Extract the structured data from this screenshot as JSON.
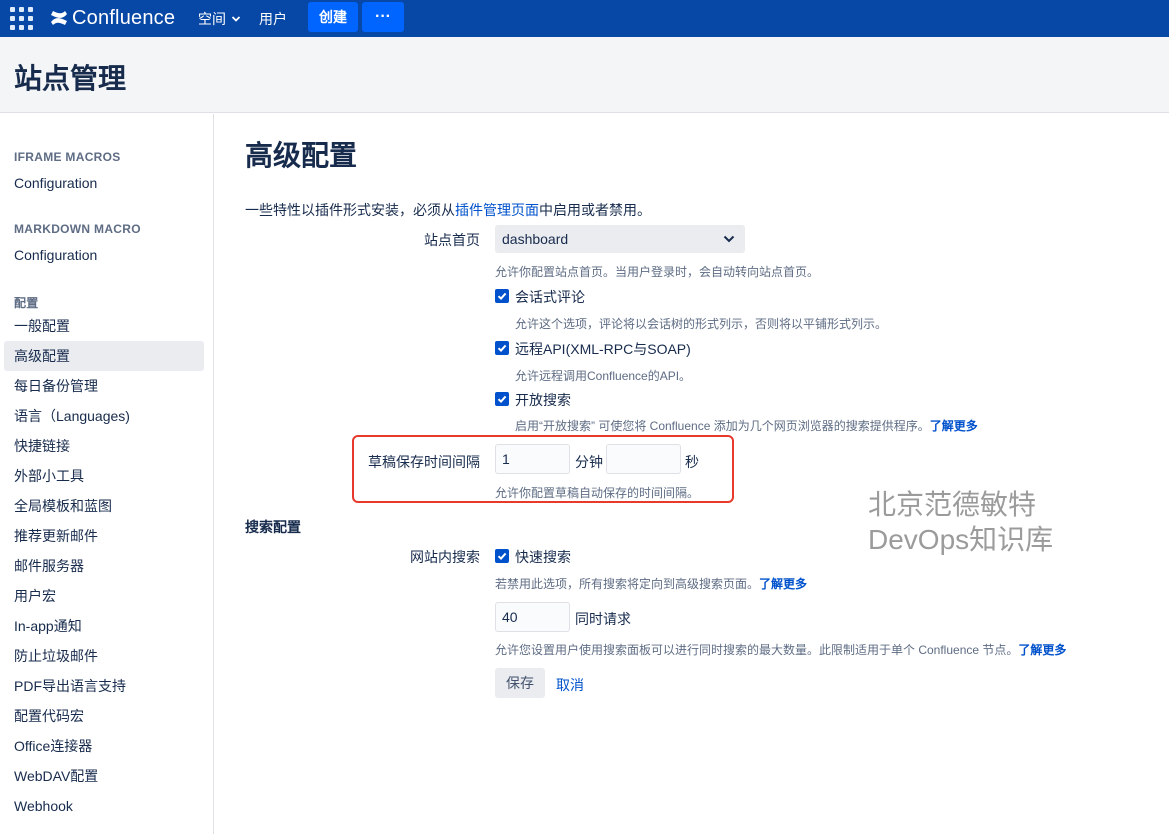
{
  "topbar": {
    "app_name": "Confluence",
    "nav_spaces": "空间",
    "nav_people": "用户",
    "create_label": "创建",
    "more_label": "···"
  },
  "page_header": {
    "title": "站点管理"
  },
  "sidebar": {
    "sections": [
      {
        "heading": "IFRAME MACROS",
        "items": [
          "Configuration"
        ]
      },
      {
        "heading": "MARKDOWN MACRO",
        "items": [
          "Configuration"
        ]
      },
      {
        "heading": "配置",
        "items": [
          "一般配置",
          "高级配置",
          "每日备份管理",
          "语言（Languages)",
          "快捷链接",
          "外部小工具",
          "全局模板和蓝图",
          "推荐更新邮件",
          "邮件服务器",
          "用户宏",
          "In-app通知",
          "防止垃圾邮件",
          "PDF导出语言支持",
          "配置代码宏",
          "Office连接器",
          "WebDAV配置",
          "Webhook"
        ]
      }
    ],
    "active_item": "高级配置"
  },
  "main": {
    "title": "高级配置",
    "intro_prefix": "一些特性以插件形式安装，必须从",
    "intro_link": "插件管理页面",
    "intro_suffix": "中启用或者禁用。",
    "site_home": {
      "label": "站点首页",
      "value": "dashboard",
      "desc": "允许你配置站点首页。当用户登录时，会自动转向站点首页。"
    },
    "threaded_comments": {
      "label": "会话式评论",
      "checked": true,
      "desc": "允许这个选项，评论将以会话树的形式列示，否则将以平铺形式列示。"
    },
    "remote_api": {
      "label": "远程API(XML-RPC与SOAP)",
      "checked": true,
      "desc": "允许远程调用Confluence的API。"
    },
    "open_search": {
      "label": "开放搜索",
      "checked": true,
      "desc": "启用“开放搜索” 可使您将 Confluence 添加为几个网页浏览器的搜索提供程序。",
      "learn_more": "了解更多"
    },
    "draft_save": {
      "label": "草稿保存时间间隔",
      "minutes_value": "1",
      "minutes_unit": "分钟",
      "seconds_value": "",
      "seconds_unit": "秒",
      "desc": "允许你配置草稿自动保存的时间间隔。"
    },
    "search_config": {
      "heading": "搜索配置",
      "site_search_label": "网站内搜索",
      "quick_search_label": "快速搜索",
      "quick_search_checked": true,
      "quick_search_desc": "若禁用此选项，所有搜索将定向到高级搜索页面。",
      "quick_search_learn_more": "了解更多",
      "concurrent_value": "40",
      "concurrent_label": "同时请求",
      "concurrent_desc": "允许您设置用户使用搜索面板可以进行同时搜索的最大数量。此限制适用于单个 Confluence 节点。",
      "concurrent_learn_more": "了解更多"
    },
    "save_label": "保存",
    "cancel_label": "取消"
  },
  "watermark": {
    "line1": "北京范德敏特",
    "line2": "DevOps知识库"
  },
  "colors": {
    "topbar": "#0747A6",
    "button": "#0065FF",
    "link": "#0052CC",
    "highlight": "#E8392D"
  }
}
